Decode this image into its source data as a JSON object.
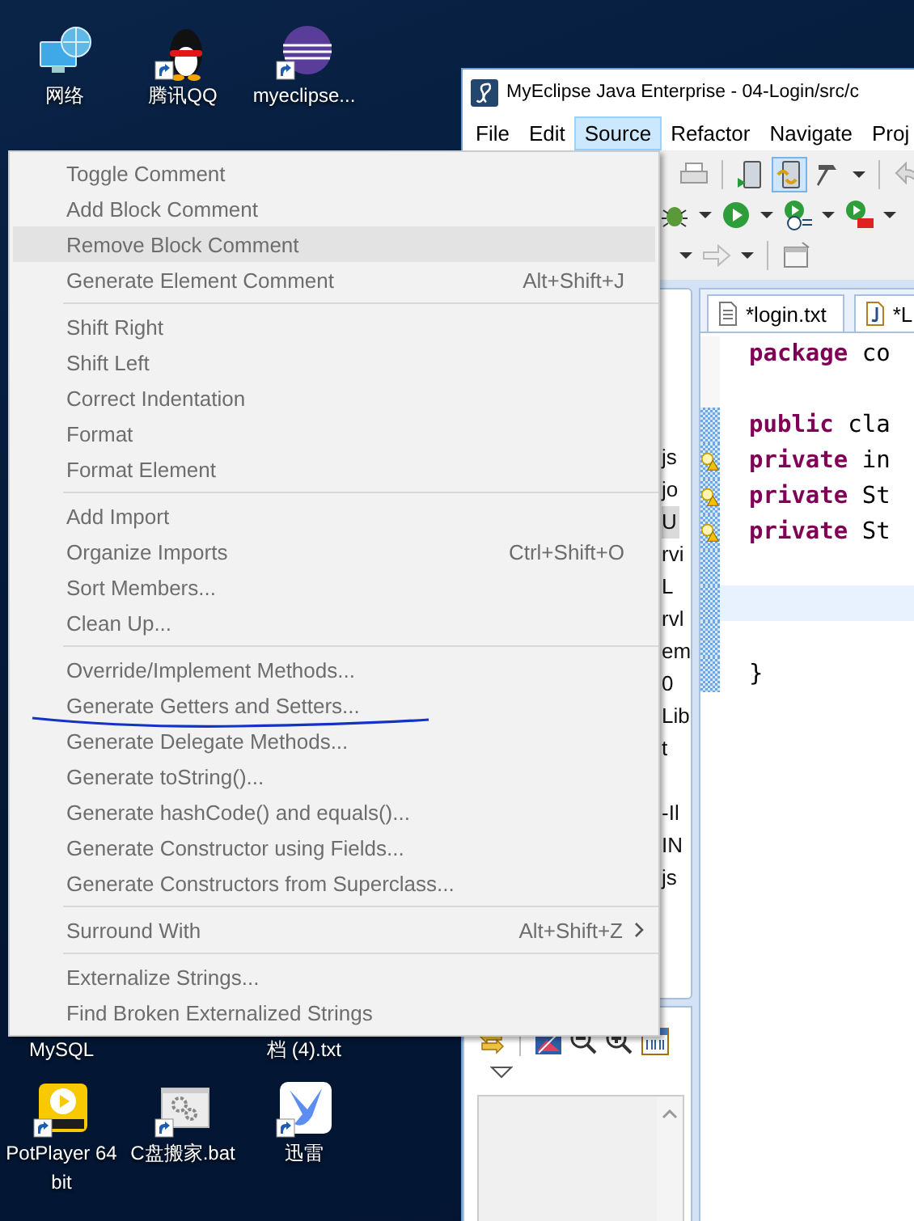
{
  "desktop_icons": [
    {
      "label": "网络",
      "kind": "network"
    },
    {
      "label": "腾讯QQ",
      "kind": "qq"
    },
    {
      "label": "myeclipse...",
      "kind": "eclipse"
    },
    {
      "label": "MySQL",
      "kind": "label_only"
    },
    {
      "label": "档 (4).txt",
      "kind": "label_only"
    },
    {
      "label": "PotPlayer 64 bit",
      "kind": "potplayer"
    },
    {
      "label": "C盘搬家.bat",
      "kind": "batch"
    },
    {
      "label": "迅雷",
      "kind": "xunlei"
    }
  ],
  "window": {
    "title": "MyEclipse Java Enterprise - 04-Login/src/c",
    "menu_bar": [
      {
        "label": "File",
        "selected": false
      },
      {
        "label": "Edit",
        "selected": false
      },
      {
        "label": "Source",
        "selected": true
      },
      {
        "label": "Refactor",
        "selected": false
      },
      {
        "label": "Navigate",
        "selected": false
      },
      {
        "label": "Proj",
        "selected": false
      }
    ],
    "toolbar_rows": [
      [
        {
          "kind": "print",
          "selected": false
        },
        {
          "kind": "sep"
        },
        {
          "kind": "device",
          "selected": false
        },
        {
          "kind": "device-sync",
          "selected": true
        },
        {
          "kind": "hammer",
          "selected": false
        },
        {
          "kind": "caret",
          "selected": false
        },
        {
          "kind": "sep"
        },
        {
          "kind": "undo",
          "selected": false
        }
      ],
      [
        {
          "kind": "bug",
          "selected": false
        },
        {
          "kind": "caret",
          "selected": false
        },
        {
          "kind": "run",
          "selected": false
        },
        {
          "kind": "caret",
          "selected": false
        },
        {
          "kind": "run-clock",
          "selected": false
        },
        {
          "kind": "caret",
          "selected": false
        },
        {
          "kind": "run-box",
          "selected": false
        },
        {
          "kind": "caret",
          "selected": false
        }
      ],
      [
        {
          "kind": "caret",
          "selected": false
        },
        {
          "kind": "forward",
          "selected": false
        },
        {
          "kind": "caret",
          "selected": false
        },
        {
          "kind": "sep"
        },
        {
          "kind": "window",
          "selected": false
        }
      ]
    ],
    "explorer_fragments": [
      {
        "text": "js",
        "selected": false
      },
      {
        "text": "jo",
        "selected": false
      },
      {
        "text": "U",
        "selected": true
      },
      {
        "text": "rvi",
        "selected": false
      },
      {
        "text": "L",
        "selected": false
      },
      {
        "text": "rvl",
        "selected": false
      },
      {
        "text": "em",
        "selected": false
      },
      {
        "text": "0",
        "selected": false
      },
      {
        "text": "Lib",
        "selected": false
      },
      {
        "text": "t",
        "selected": false
      },
      {
        "text": "-Il",
        "selected": false
      },
      {
        "text": "IN",
        "selected": false
      },
      {
        "text": "js",
        "selected": false
      }
    ],
    "editor_tabs": [
      {
        "label": "*login.txt",
        "kind": "text"
      },
      {
        "label": "*L",
        "kind": "java"
      }
    ],
    "code_lines": [
      {
        "keyword": "package",
        "rest": " co",
        "current": false,
        "changed": false,
        "warning": false
      },
      {
        "current": false,
        "changed": false,
        "warning": false
      },
      {
        "keyword": "public",
        "rest": " cla",
        "current": false,
        "changed": true,
        "warning": false
      },
      {
        "keyword": "private",
        "rest": " in",
        "current": false,
        "changed": true,
        "warning": true
      },
      {
        "keyword": "private",
        "rest": " St",
        "current": false,
        "changed": true,
        "warning": true
      },
      {
        "keyword": "private",
        "rest": " St",
        "current": false,
        "changed": true,
        "warning": true
      },
      {
        "current": false,
        "changed": true,
        "warning": false
      },
      {
        "current": true,
        "changed": true,
        "warning": false
      },
      {
        "current": false,
        "changed": true,
        "warning": false
      },
      {
        "rest": "}",
        "current": false,
        "changed": true,
        "warning": false
      }
    ]
  },
  "context_menu": {
    "groups": [
      {
        "items": [
          {
            "label": "Toggle Comment",
            "highlighted": false,
            "submenu": false
          },
          {
            "label": "Add Block Comment",
            "highlighted": false,
            "submenu": false
          },
          {
            "label": "Remove Block Comment",
            "highlighted": true,
            "submenu": false
          },
          {
            "label": "Generate Element Comment",
            "shortcut": "Alt+Shift+J",
            "highlighted": false,
            "submenu": false
          }
        ]
      },
      {
        "items": [
          {
            "label": "Shift Right",
            "highlighted": false,
            "submenu": false
          },
          {
            "label": "Shift Left",
            "highlighted": false,
            "submenu": false
          },
          {
            "label": "Correct Indentation",
            "highlighted": false,
            "submenu": false
          },
          {
            "label": "Format",
            "highlighted": false,
            "submenu": false
          },
          {
            "label": "Format Element",
            "highlighted": false,
            "submenu": false
          }
        ]
      },
      {
        "items": [
          {
            "label": "Add Import",
            "highlighted": false,
            "submenu": false
          },
          {
            "label": "Organize Imports",
            "shortcut": "Ctrl+Shift+O",
            "highlighted": false,
            "submenu": false
          },
          {
            "label": "Sort Members...",
            "highlighted": false,
            "submenu": false
          },
          {
            "label": "Clean Up...",
            "highlighted": false,
            "submenu": false
          }
        ]
      },
      {
        "items": [
          {
            "label": "Override/Implement Methods...",
            "highlighted": false,
            "submenu": false
          },
          {
            "label": "Generate Getters and Setters...",
            "highlighted": false,
            "submenu": false
          },
          {
            "label": "Generate Delegate Methods...",
            "highlighted": false,
            "submenu": false
          },
          {
            "label": "Generate toString()...",
            "highlighted": false,
            "submenu": false
          },
          {
            "label": "Generate hashCode() and equals()...",
            "highlighted": false,
            "submenu": false
          },
          {
            "label": "Generate Constructor using Fields...",
            "highlighted": false,
            "submenu": false
          },
          {
            "label": "Generate Constructors from Superclass...",
            "highlighted": false,
            "submenu": false
          }
        ]
      },
      {
        "items": [
          {
            "label": "Surround With",
            "shortcut": "Alt+Shift+Z",
            "highlighted": false,
            "submenu": true
          }
        ]
      },
      {
        "items": [
          {
            "label": "Externalize Strings...",
            "highlighted": false,
            "submenu": false
          },
          {
            "label": "Find Broken Externalized Strings",
            "highlighted": false,
            "submenu": false
          }
        ]
      }
    ]
  }
}
